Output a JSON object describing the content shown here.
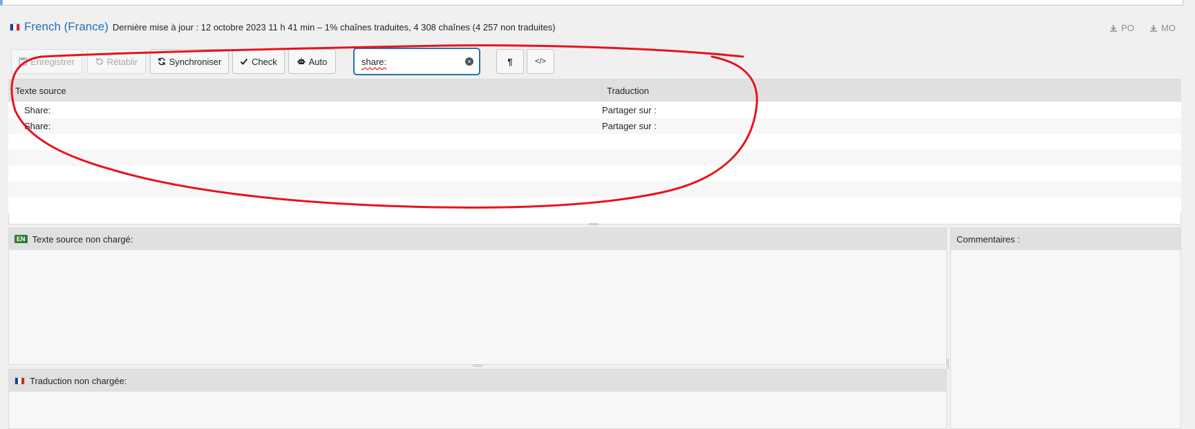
{
  "header": {
    "language": "French (France)",
    "meta": "Dernière mise à jour : 12 octobre 2023 11 h 41 min – 1% chaînes traduites, 4 308 chaînes (4 257 non traduites)",
    "downloads": [
      {
        "label": "PO",
        "icon": "download-icon"
      },
      {
        "label": "MO",
        "icon": "download-icon"
      }
    ]
  },
  "toolbar": {
    "save_label": "Enregistrer",
    "revert_label": "Rétablir",
    "sync_label": "Synchroniser",
    "check_label": "Check",
    "auto_label": "Auto",
    "search_value": "share:",
    "pilcrow_label": "¶",
    "code_label": "</>"
  },
  "table": {
    "columns": [
      "Texte source",
      "Traduction"
    ],
    "rows": [
      {
        "source": "Share:",
        "translation": "Partager sur :"
      },
      {
        "source": "Share:",
        "translation": "Partager sur :"
      }
    ]
  },
  "source_pane": {
    "badge": "EN",
    "title": "Texte source non chargé:"
  },
  "translation_pane": {
    "title": "Traduction non chargée:"
  },
  "comments_pane": {
    "title": "Commentaires :"
  },
  "colors": {
    "link": "#2271b1",
    "annotation": "#e8121b",
    "badge": "#2e7d32"
  }
}
